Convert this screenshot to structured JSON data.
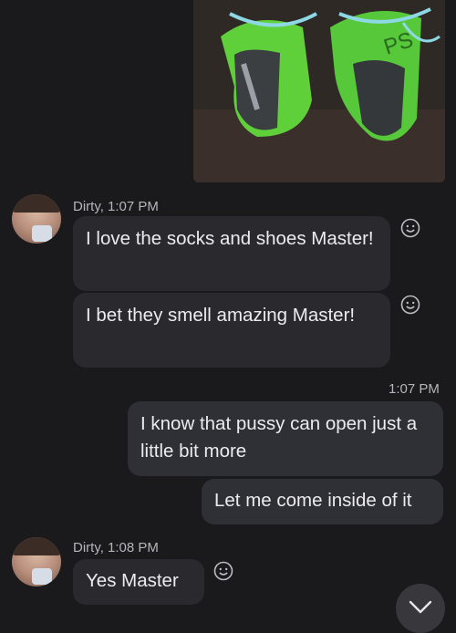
{
  "messages": {
    "group1": {
      "sender": "Dirty, 1:07 PM",
      "bubble1": "I love the socks and shoes Master!",
      "bubble2": "I bet they smell amazing Master!"
    },
    "outgoing": {
      "time": "1:07 PM",
      "bubble1": "I know that pussy can open just a little bit more",
      "bubble2": "Let me come inside of it"
    },
    "group2": {
      "sender": "Dirty, 1:08 PM",
      "bubble1": "Yes Master"
    }
  },
  "icons": {
    "react": "smiley-add-reaction-icon",
    "scroll": "chevron-down-icon"
  },
  "colors": {
    "background": "#1a1a1c",
    "incoming_bubble": "#2a2a2e",
    "outgoing_bubble": "#2f3035",
    "meta_text": "#b6b6ba"
  }
}
